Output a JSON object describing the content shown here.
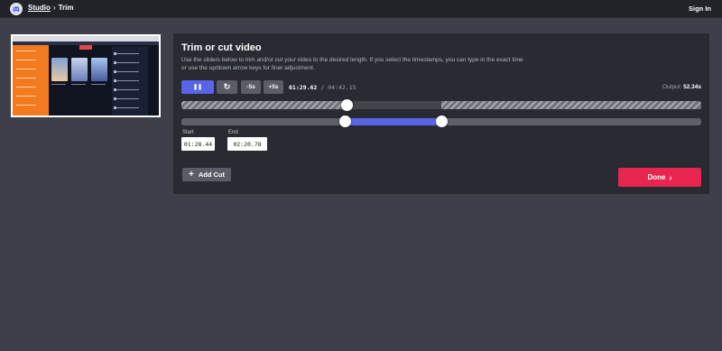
{
  "topbar": {
    "logo_icon": "discord-logo-icon",
    "breadcrumb": {
      "link": "Studio",
      "separator": "›",
      "current": "Trim"
    },
    "signin_label": "Sign In"
  },
  "preview": {
    "icon": "video-thumbnail"
  },
  "panel": {
    "title": "Trim or cut video",
    "description": "Use the sliders below to trim and/or cut your video to the desired length. If you select the timestamps, you can type in the exact time or use the up/down arrow keys for finer adjustment.",
    "controls": {
      "pause_icon": "pause-icon",
      "pause_glyph": "❚❚",
      "reset_icon": "reset-icon",
      "reset_glyph": "↻",
      "minus5_label": "-5s",
      "plus5_label": "+5s"
    },
    "time_current": "01:29.62",
    "time_separator": "/",
    "time_total": "04:42.15",
    "output_label": "Output:",
    "output_value": "52.34s",
    "timeline": {
      "playhead_fraction": 0.318,
      "keep_start_fraction": 0.315,
      "keep_end_fraction": 0.5
    },
    "start_label": "Start",
    "start_value": "01:28.44",
    "end_label": "End",
    "end_value": "02:20.78",
    "add_cut_label": "Add Cut",
    "add_cut_glyph": "+",
    "done_label": "Done",
    "done_glyph": "›"
  },
  "colors": {
    "accent": "#5865e8",
    "done": "#e8254e",
    "background": "#3d4049",
    "panel": "#292b32"
  }
}
